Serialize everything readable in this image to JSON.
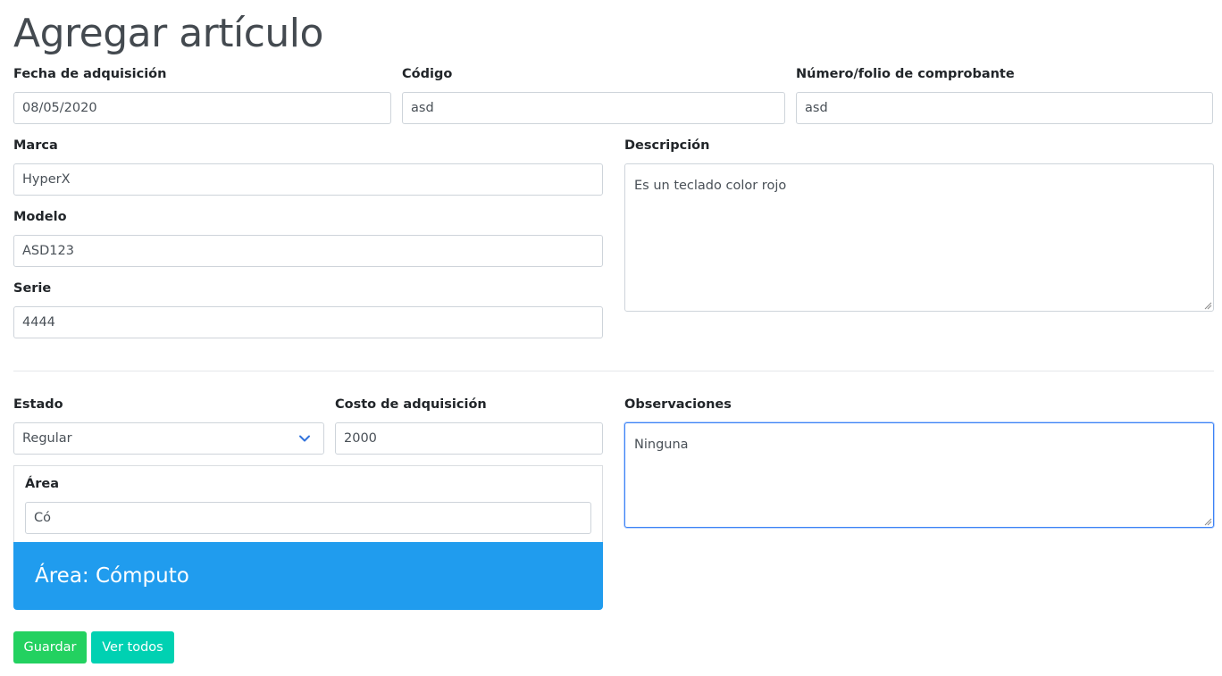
{
  "page_title": "Agregar artículo",
  "fields": {
    "fecha": {
      "label": "Fecha de adquisición",
      "value": "08/05/2020"
    },
    "codigo": {
      "label": "Código",
      "value": "asd"
    },
    "folio": {
      "label": "Número/folio de comprobante",
      "value": "asd"
    },
    "marca": {
      "label": "Marca",
      "value": "HyperX"
    },
    "modelo": {
      "label": "Modelo",
      "value": "ASD123"
    },
    "serie": {
      "label": "Serie",
      "value": "4444"
    },
    "descripcion": {
      "label": "Descripción",
      "value": "Es un teclado color rojo"
    },
    "estado": {
      "label": "Estado",
      "value": "Regular"
    },
    "costo": {
      "label": "Costo de adquisición",
      "value": "2000"
    },
    "observaciones": {
      "label": "Observaciones",
      "value": "Ninguna"
    },
    "area": {
      "label": "Área",
      "value": "Có"
    }
  },
  "area_banner": "Área: Cómputo",
  "buttons": {
    "save": "Guardar",
    "view_all": "Ver todos"
  },
  "colors": {
    "banner": "#209cee",
    "save_button": "#23d160",
    "view_button": "#00d1b2",
    "focus_border": "#3b82f6"
  },
  "icons": {
    "select_arrow": "chevron-down-icon",
    "resize_handle": "resize-grip-icon"
  }
}
